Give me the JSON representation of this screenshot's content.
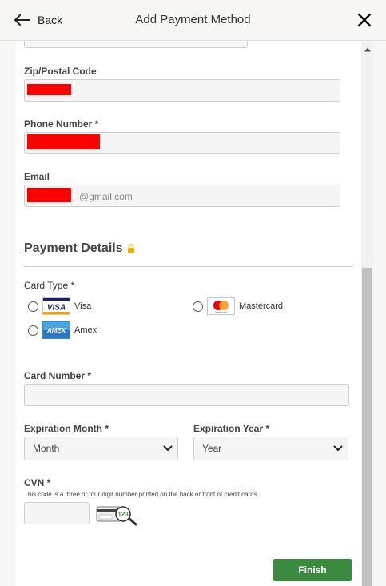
{
  "header": {
    "back_label": "Back",
    "title": "Add Payment Method"
  },
  "billing": {
    "zip_label": "Zip/Postal Code",
    "phone_label": "Phone Number *",
    "email_label": "Email",
    "email_visible_suffix": "@gmail.com"
  },
  "payment": {
    "section_title": "Payment Details",
    "card_type_label": "Card Type *",
    "card_types": [
      {
        "name": "Visa",
        "logo_text": "VISA"
      },
      {
        "name": "Mastercard",
        "logo_text": "mastercard"
      },
      {
        "name": "Amex",
        "logo_text": "AMEX"
      }
    ],
    "card_number_label": "Card Number *",
    "exp_month_label": "Expiration Month *",
    "exp_month_value": "Month",
    "exp_year_label": "Expiration Year *",
    "exp_year_value": "Year",
    "cvn_label": "CVN *",
    "cvn_help": "This code is a three or four digit number printed on the back or front of credit cards.",
    "cvn_sample_digits": "123"
  },
  "actions": {
    "finish_label": "Finish"
  },
  "colors": {
    "accent_green": "#3c8a3f",
    "redaction": "#ff0000",
    "lock": "#e6b400"
  },
  "icons": [
    "back-arrow-icon",
    "close-icon",
    "lock-icon",
    "scroll-up-arrow-icon",
    "chevron-down-icon",
    "cvn-magnifier-icon"
  ]
}
